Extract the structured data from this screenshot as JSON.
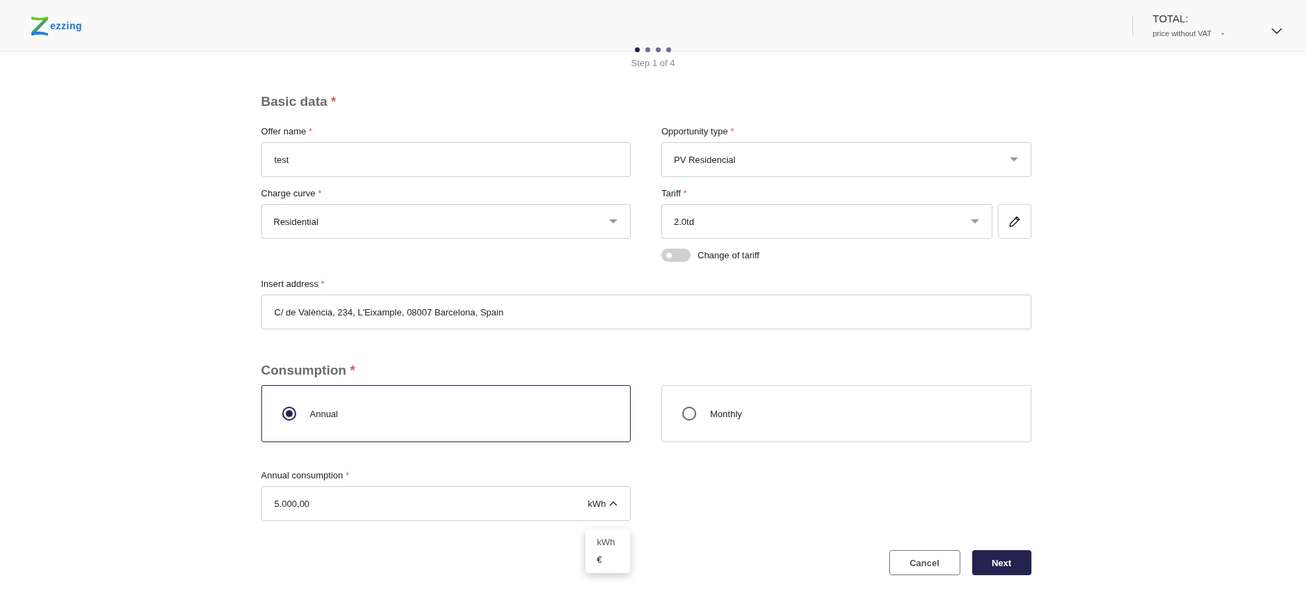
{
  "header": {
    "logo_text": "ezzing",
    "total_label": "TOTAL:",
    "price_label": "price without VAT",
    "price_value": "-"
  },
  "stepper": {
    "steps": [
      {
        "selected": true
      },
      {
        "selected": false
      },
      {
        "selected": false
      },
      {
        "selected": false
      }
    ],
    "caption": "Step 1 of 4"
  },
  "basic_data": {
    "title": "Basic data",
    "mark": "*",
    "fields": [
      {
        "kind": "text",
        "label": "Offer name",
        "mark": "*",
        "value": "test"
      },
      {
        "kind": "select",
        "label": "Opportunity type",
        "mark": "*",
        "value": "PV Residencial"
      },
      {
        "kind": "select",
        "label": "Charge curve",
        "mark": "*",
        "value": "Residential"
      },
      {
        "kind": "select_edit",
        "label": "Tariff",
        "mark": "*",
        "value": "2.0td",
        "toggle": {
          "label": "Change of tariff",
          "on": false
        }
      },
      {
        "kind": "wide",
        "label": "Insert address",
        "mark": "*",
        "value": "C/ de València, 234, L'Eixample, 08007 Barcelona, Spain"
      }
    ]
  },
  "consumption": {
    "title": "Consumption",
    "mark": "*",
    "options": [
      {
        "label": "Annual",
        "selected": true
      },
      {
        "label": "Monthly",
        "selected": false
      }
    ],
    "annual_consumption": {
      "label": "Annual consumption",
      "mark": "*",
      "value": "5.000,00",
      "unit": "kWh",
      "expanded": true,
      "menu": [
        "kWh",
        "€"
      ]
    }
  },
  "actions": {
    "cancel": "Cancel",
    "next": "Next"
  }
}
